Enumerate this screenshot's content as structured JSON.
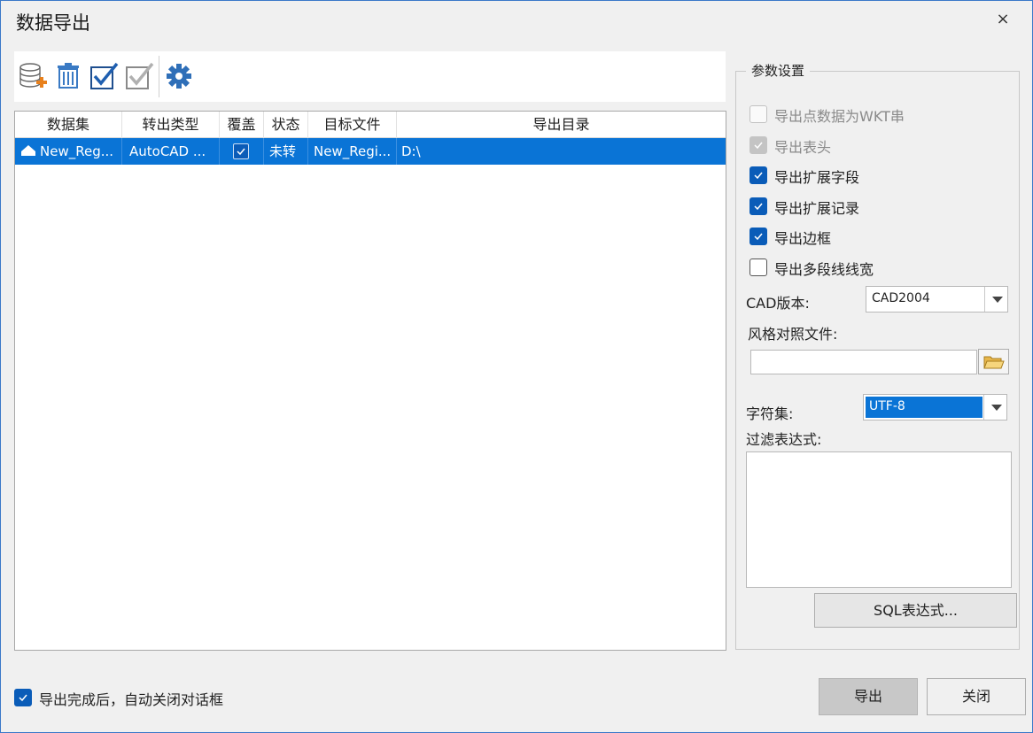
{
  "window": {
    "title": "数据导出",
    "close_glyph": "×"
  },
  "toolbar": {
    "buttons": [
      "add-dataset-icon",
      "delete-icon",
      "check-all-icon",
      "uncheck-all-icon",
      "settings-icon"
    ]
  },
  "table": {
    "columns": [
      "数据集",
      "转出类型",
      "覆盖",
      "状态",
      "目标文件",
      "导出目录"
    ],
    "rows": [
      {
        "dataset": "New_Reg...",
        "type": "AutoCAD ...",
        "overwrite": true,
        "status": "未转",
        "target": "New_Regi...",
        "dir": "D:\\"
      }
    ]
  },
  "params": {
    "group_title": "参数设置",
    "options": [
      {
        "label": "导出点数据为WKT串",
        "checked": false,
        "enabled": false
      },
      {
        "label": "导出表头",
        "checked": true,
        "enabled": false
      },
      {
        "label": "导出扩展字段",
        "checked": true,
        "enabled": true
      },
      {
        "label": "导出扩展记录",
        "checked": true,
        "enabled": true
      },
      {
        "label": "导出边框",
        "checked": true,
        "enabled": true
      },
      {
        "label": "导出多段线线宽",
        "checked": false,
        "enabled": true
      }
    ],
    "cad_version_label": "CAD版本:",
    "cad_version_value": "CAD2004",
    "style_file_label": "风格对照文件:",
    "style_file_value": "",
    "charset_label": "字符集:",
    "charset_value": "UTF-8",
    "filter_label": "过滤表达式:",
    "filter_value": "",
    "sql_button": "SQL表达式..."
  },
  "footer": {
    "auto_close_label": "导出完成后，自动关闭对话框",
    "auto_close_checked": true,
    "export_button": "导出",
    "close_button": "关闭"
  },
  "colors": {
    "selection": "#0a74d6",
    "accent": "#0a5cb8"
  }
}
